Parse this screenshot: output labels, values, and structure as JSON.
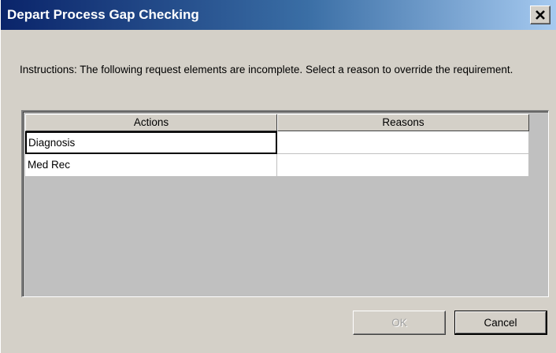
{
  "window": {
    "title": "Depart Process Gap Checking",
    "close_icon": "close-icon"
  },
  "instructions": "Instructions: The following request elements are incomplete. Select a reason to override the requirement.",
  "grid": {
    "columns": [
      "Actions",
      "Reasons"
    ],
    "rows": [
      {
        "action": "Diagnosis",
        "reason": ""
      },
      {
        "action": "Med Rec",
        "reason": ""
      }
    ]
  },
  "buttons": {
    "ok_label": "OK",
    "ok_enabled": false,
    "cancel_label": "Cancel"
  },
  "colors": {
    "title_gradient_start": "#0a246a",
    "title_gradient_end": "#a6caf0",
    "dialog_bg": "#d4d0c8",
    "grid_bg": "#c0c0c0"
  }
}
